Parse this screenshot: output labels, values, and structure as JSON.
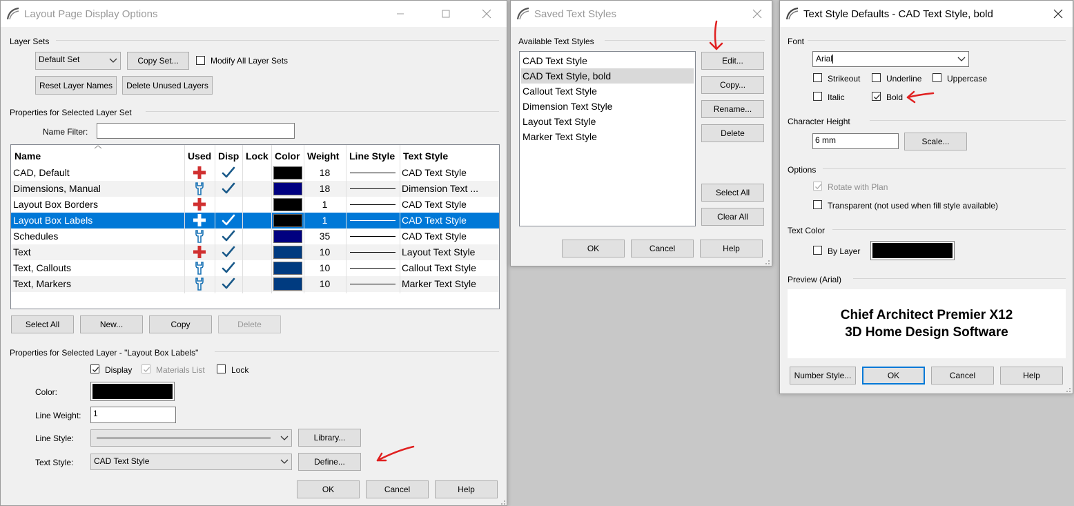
{
  "layout_window": {
    "title": "Layout Page Display Options",
    "layer_sets": {
      "group_label": "Layer Sets",
      "selected_set": "Default Set",
      "copy_set": "Copy Set...",
      "modify_all_label": "Modify All Layer Sets",
      "modify_all_checked": false,
      "reset_names": "Reset Layer Names",
      "delete_unused": "Delete Unused Layers"
    },
    "props_set": {
      "group_label": "Properties for Selected Layer Set",
      "name_filter_label": "Name Filter:",
      "name_filter_value": ""
    },
    "table": {
      "headers": [
        "Name",
        "Used",
        "Disp",
        "Lock",
        "Color",
        "Weight",
        "Line Style",
        "Text Style"
      ],
      "rows": [
        {
          "name": "CAD,  Default",
          "used": "plus",
          "disp": true,
          "color": "#000000",
          "weight": "18",
          "text_style": "CAD Text Style"
        },
        {
          "name": "Dimensions,  Manual",
          "used": "wrench",
          "disp": true,
          "color": "#000080",
          "weight": "18",
          "text_style": "Dimension Text ..."
        },
        {
          "name": "Layout Box Borders",
          "used": "plus",
          "disp": false,
          "color": "#000000",
          "weight": "1",
          "text_style": "CAD Text Style"
        },
        {
          "name": "Layout Box Labels",
          "used": "plus",
          "disp": true,
          "color": "#000000",
          "weight": "1",
          "text_style": "CAD Text Style",
          "selected": true
        },
        {
          "name": "Schedules",
          "used": "wrench",
          "disp": true,
          "color": "#000080",
          "weight": "35",
          "text_style": "CAD Text Style"
        },
        {
          "name": "Text",
          "used": "plus",
          "disp": true,
          "color": "#003b80",
          "weight": "10",
          "text_style": "Layout Text Style"
        },
        {
          "name": "Text,  Callouts",
          "used": "wrench",
          "disp": true,
          "color": "#003b80",
          "weight": "10",
          "text_style": "Callout Text Style"
        },
        {
          "name": "Text,  Markers",
          "used": "wrench",
          "disp": true,
          "color": "#003b80",
          "weight": "10",
          "text_style": "Marker Text Style"
        }
      ]
    },
    "buttons": {
      "select_all": "Select All",
      "new": "New...",
      "copy": "Copy",
      "delete": "Delete"
    },
    "props_layer": {
      "group_label": "Properties for Selected Layer - \"Layout Box Labels\"",
      "display_label": "Display",
      "display_checked": true,
      "materials_label": "Materials List",
      "materials_checked": true,
      "lock_label": "Lock",
      "lock_checked": false,
      "color_label": "Color:",
      "color_value": "#000000",
      "line_weight_label": "Line Weight:",
      "line_weight_value": "1",
      "line_style_label": "Line Style:",
      "library": "Library...",
      "text_style_label": "Text Style:",
      "text_style_value": "CAD Text Style",
      "define": "Define..."
    },
    "footer": {
      "ok": "OK",
      "cancel": "Cancel",
      "help": "Help"
    }
  },
  "saved_window": {
    "title": "Saved Text Styles",
    "group_label": "Available Text Styles",
    "styles": [
      {
        "label": "CAD Text Style"
      },
      {
        "label": "CAD Text Style, bold",
        "selected": true
      },
      {
        "label": "Callout Text Style"
      },
      {
        "label": "Dimension Text Style"
      },
      {
        "label": "Layout Text Style"
      },
      {
        "label": "Marker Text Style"
      }
    ],
    "buttons": {
      "edit": "Edit...",
      "copy": "Copy...",
      "rename": "Rename...",
      "delete": "Delete",
      "select_all": "Select All",
      "clear_all": "Clear All"
    },
    "footer": {
      "ok": "OK",
      "cancel": "Cancel",
      "help": "Help"
    }
  },
  "defaults_window": {
    "title": "Text Style Defaults - CAD Text Style, bold",
    "font": {
      "group_label": "Font",
      "value": "Arial",
      "strikeout": "Strikeout",
      "underline": "Underline",
      "uppercase": "Uppercase",
      "italic": "Italic",
      "bold": "Bold",
      "bold_checked": true
    },
    "char_height": {
      "group_label": "Character Height",
      "value": "6 mm",
      "scale": "Scale..."
    },
    "options": {
      "group_label": "Options",
      "rotate": "Rotate with Plan",
      "rotate_checked": true,
      "transparent": "Transparent (not used when fill style available)"
    },
    "text_color": {
      "group_label": "Text Color",
      "by_layer": "By Layer",
      "color": "#000000"
    },
    "preview": {
      "group_label": "Preview (Arial)",
      "line1": "Chief Architect Premier X12",
      "line2": "3D Home Design Software"
    },
    "footer": {
      "number_style": "Number Style...",
      "ok": "OK",
      "cancel": "Cancel",
      "help": "Help"
    }
  },
  "accent_colors": {
    "selection": "#0078d7",
    "annotation_arrow": "#e02020",
    "used_plus": "#d03030",
    "used_wrench": "#1a73b5",
    "check": "#1a5a8a"
  }
}
